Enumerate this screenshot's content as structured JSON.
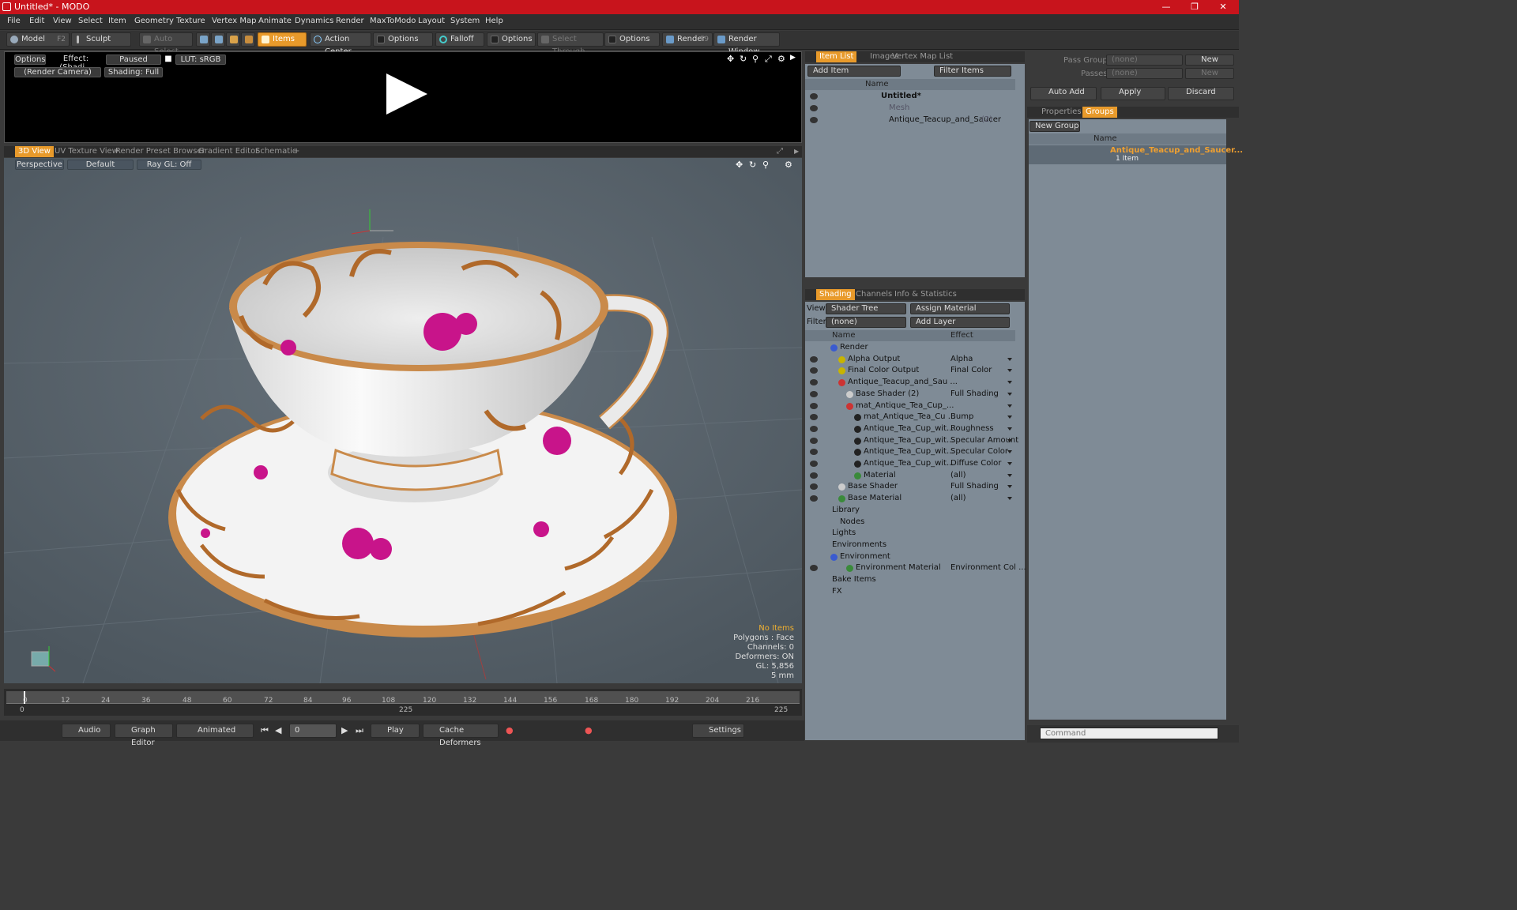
{
  "window": {
    "title": "Untitled* - MODO"
  },
  "menu": [
    "File",
    "Edit",
    "View",
    "Select",
    "Item",
    "Geometry",
    "Texture",
    "Vertex Map",
    "Animate",
    "Dynamics",
    "Render",
    "MaxToModo",
    "Layout",
    "System",
    "Help"
  ],
  "toolbar": {
    "model": "Model",
    "model_key": "F2",
    "sculpt": "Sculpt",
    "auto_select": "Auto Select",
    "items": "Items",
    "action_center": "Action Center",
    "options1": "Options",
    "falloff": "Falloff",
    "options2": "Options",
    "select_through": "Select Through",
    "options3": "Options",
    "render": "Render",
    "render_key": "F9",
    "render_window": "Render Window"
  },
  "preview": {
    "options": "Options",
    "effect": "Effect: (Shadi...",
    "paused": "Paused",
    "lut": "LUT: sRGB",
    "camera": "(Render Camera)",
    "shading": "Shading: Full"
  },
  "view_tabs": [
    "3D View",
    "UV Texture View",
    "Render Preset Browser",
    "Gradient Editor",
    "Schematic"
  ],
  "viewport": {
    "perspective": "Perspective",
    "default": "Default",
    "raygl": "Ray GL: Off",
    "hud": {
      "no_items": "No Items",
      "polygons": "Polygons : Face",
      "channels": "Channels: 0",
      "deformers": "Deformers: ON",
      "gl": "GL: 5,856",
      "scale": "5 mm"
    }
  },
  "timeline": {
    "ticks": [
      "0",
      "12",
      "24",
      "36",
      "48",
      "60",
      "72",
      "84",
      "96",
      "108",
      "120",
      "132",
      "144",
      "156",
      "168",
      "180",
      "192",
      "204",
      "216"
    ],
    "start": "0",
    "mid": "225",
    "end": "225"
  },
  "bottom": {
    "audio": "Audio",
    "graph_editor": "Graph Editor",
    "animated": "Animated",
    "frame": "0",
    "play": "Play",
    "cache_deformers": "Cache Deformers",
    "settings": "Settings"
  },
  "item_list": {
    "tabs": [
      "Item List",
      "Images",
      "Vertex Map List"
    ],
    "add_item": "Add Item",
    "filter_items": "Filter Items",
    "name_col": "Name",
    "items": [
      {
        "name": "Untitled*",
        "count": ""
      },
      {
        "name": "Mesh",
        "count": ""
      },
      {
        "name": "Antique_Teacup_and_Saucer",
        "count": "(2)"
      }
    ]
  },
  "shading": {
    "tabs": [
      "Shading",
      "Channels",
      "Info & Statistics"
    ],
    "view_label": "View",
    "view_value": "Shader Tree",
    "assign_material": "Assign Material",
    "filter_label": "Filter",
    "filter_value": "(none)",
    "add_layer": "Add Layer",
    "name_col": "Name",
    "effect_col": "Effect",
    "rows": [
      {
        "name": "Render",
        "effect": ""
      },
      {
        "name": "Alpha Output",
        "effect": "Alpha"
      },
      {
        "name": "Final Color Output",
        "effect": "Final Color"
      },
      {
        "name": "Antique_Teacup_and_Sau ...",
        "effect": ""
      },
      {
        "name": "Base Shader (2)",
        "effect": "Full Shading"
      },
      {
        "name": "mat_Antique_Tea_Cup_...",
        "effect": ""
      },
      {
        "name": "mat_Antique_Tea_Cu ...",
        "effect": "Bump"
      },
      {
        "name": "Antique_Tea_Cup_wit...",
        "effect": "Roughness"
      },
      {
        "name": "Antique_Tea_Cup_wit...",
        "effect": "Specular Amount"
      },
      {
        "name": "Antique_Tea_Cup_wit...",
        "effect": "Specular Color"
      },
      {
        "name": "Antique_Tea_Cup_wit...",
        "effect": "Diffuse Color"
      },
      {
        "name": "Material",
        "effect": "(all)"
      },
      {
        "name": "Base Shader",
        "effect": "Full Shading"
      },
      {
        "name": "Base Material",
        "effect": "(all)"
      },
      {
        "name": "Library",
        "effect": ""
      },
      {
        "name": "Nodes",
        "effect": ""
      },
      {
        "name": "Lights",
        "effect": ""
      },
      {
        "name": "Environments",
        "effect": ""
      },
      {
        "name": "Environment",
        "effect": ""
      },
      {
        "name": "Environment Material",
        "effect": "Environment Col ..."
      },
      {
        "name": "Bake Items",
        "effect": ""
      },
      {
        "name": "FX",
        "effect": ""
      }
    ]
  },
  "groups_panel": {
    "pass_groups_label": "Pass Groups",
    "pass_groups_value": "(none)",
    "new1": "New",
    "passes_label": "Passes",
    "passes_value": "(none)",
    "new2": "New",
    "auto_add": "Auto Add",
    "apply": "Apply",
    "discard": "Discard",
    "tabs": [
      "Properties",
      "Groups"
    ],
    "new_group": "New Group",
    "name_col": "Name",
    "group_name": "Antique_Teacup_and_Saucer...",
    "group_count": "1 Item"
  },
  "command": {
    "placeholder": "Command"
  }
}
